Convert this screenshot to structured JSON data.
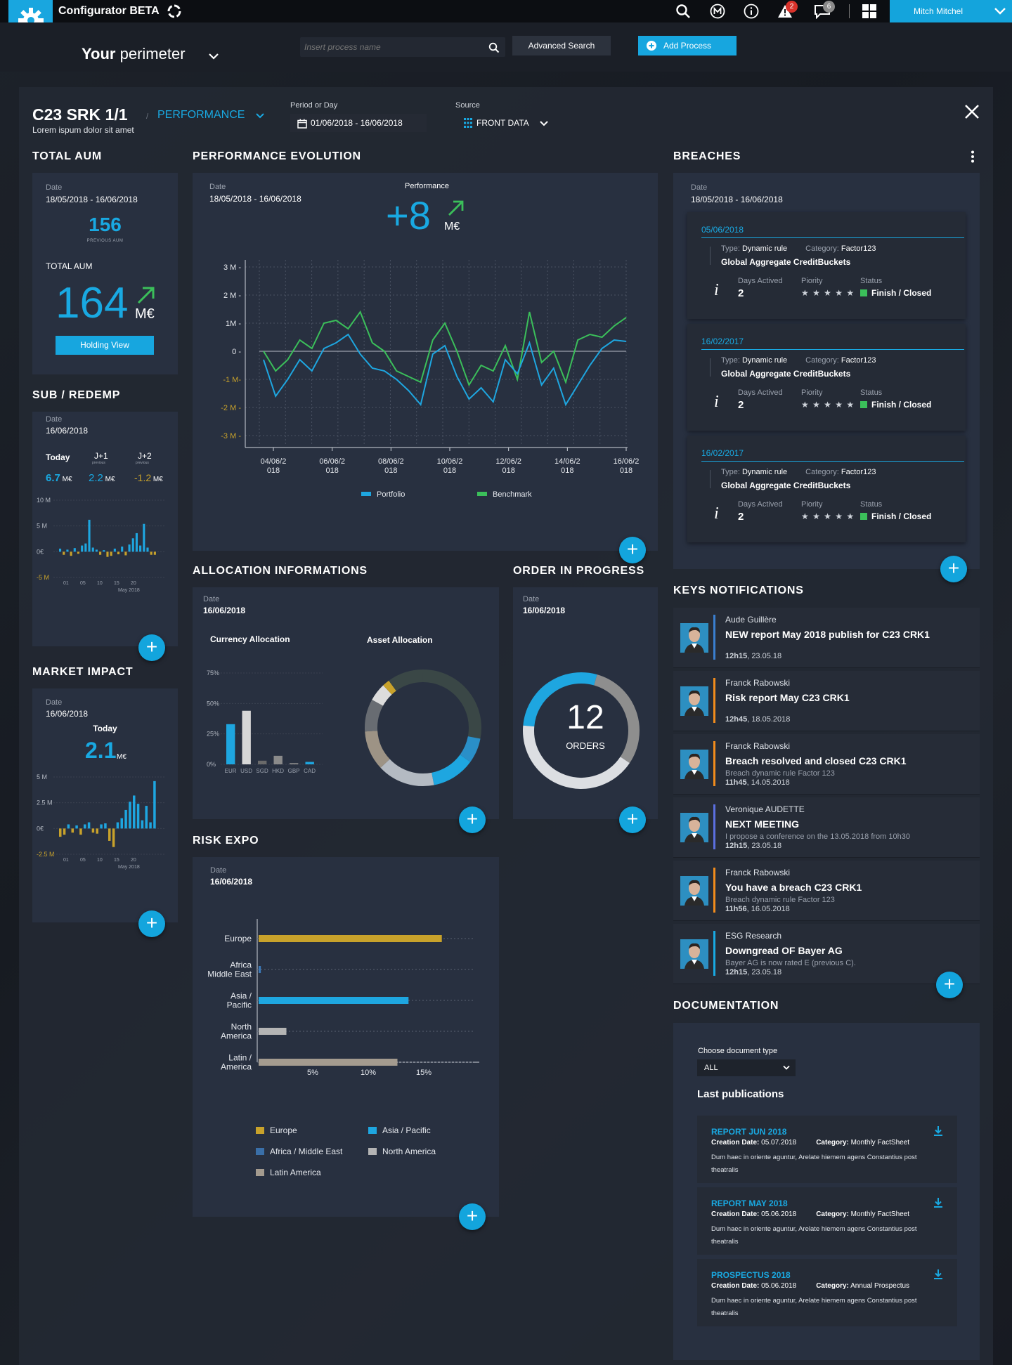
{
  "topbar": {
    "app_title": "Configurator BETA",
    "alerts_count": "2",
    "messages_count": "6",
    "user_name": "Mitch Mitchel"
  },
  "subbar": {
    "perimeter_bold": "Your",
    "perimeter_rest": " perimeter",
    "search_placeholder": "Insert process name",
    "advanced_search": "Advanced Search",
    "add_process": "Add Process"
  },
  "header": {
    "title": "C23 SRK 1/1",
    "subtitle": "Lorem ispum dolor sit amet",
    "view": "PERFORMANCE",
    "period_label": "Period or Day",
    "period_value": "01/06/2018 - 16/06/2018",
    "source_label": "Source",
    "source_value": "FRONT DATA"
  },
  "total_aum": {
    "title": "TOTAL AUM",
    "date_label": "Date",
    "date_value": "18/05/2018 - 16/06/2018",
    "previous_value": "156",
    "previous_label": "PREVIOUS AUM",
    "current_label": "TOTAL  AUM",
    "current_value": "164",
    "unit": "M€",
    "button": "Holding View"
  },
  "sub_redemp": {
    "title": "SUB / REDEMP",
    "date_label": "Date",
    "date_value": "16/06/2018",
    "today_label": "Today",
    "j1_label": "J+1",
    "j1_sub": "previous",
    "j2_label": "J+2",
    "j2_sub": "previous",
    "today_value": "6.7",
    "j1_value": "2.2",
    "j2_value": "-1.2",
    "unit": "M€",
    "y_ticks": [
      "10 M",
      "5 M",
      "0€",
      "-5 M"
    ],
    "x_ticks": [
      "01",
      "05",
      "10",
      "15",
      "20"
    ],
    "x_caption": "May 2018",
    "bars": [
      0.3,
      -0.3,
      0.2,
      -0.4,
      0.35,
      -0.2,
      0.6,
      0.8,
      3.1,
      0.4,
      0.2,
      -0.3,
      0.15,
      -0.5,
      -0.4,
      0.3,
      -0.25,
      0.5,
      -0.35,
      0.7,
      1.3,
      1.8,
      0.6,
      2.7,
      0.4,
      -0.3,
      -0.3
    ]
  },
  "market_impact": {
    "title": "MARKET IMPACT",
    "date_label": "Date",
    "date_value": "16/06/2018",
    "today_label": "Today",
    "value": "2.1",
    "unit": "M€",
    "y_ticks": [
      "5 M",
      "2.5 M",
      "0€",
      "-2.5 M"
    ],
    "x_ticks": [
      "01",
      "05",
      "10",
      "15",
      "20"
    ],
    "x_caption": "May 2018",
    "bars": [
      -0.4,
      -0.3,
      0.2,
      -0.2,
      0.15,
      -0.3,
      0.2,
      0.3,
      -0.2,
      -0.25,
      0.2,
      0.25,
      -0.6,
      -0.9,
      0.3,
      0.5,
      0.9,
      1.3,
      1.6,
      1.2,
      0.4,
      1.1,
      0.3,
      2.3
    ]
  },
  "performance": {
    "title": "PERFORMANCE EVOLUTION",
    "date_label": "Date",
    "date_value": "18/05/2018 - 16/06/2018",
    "perf_label": "Performance",
    "perf_value": "+8",
    "perf_unit": "M€"
  },
  "allocation": {
    "title": "ALLOCATION INFORMATIONS",
    "date_label": "Date",
    "date_value": "16/06/2018",
    "currency_title": "Currency Allocation",
    "asset_title": "Asset Allocation"
  },
  "order": {
    "title": "ORDER IN PROGRESS",
    "date_label": "Date",
    "date_value": "16/06/2018",
    "count": "12",
    "label": "ORDERS"
  },
  "risk": {
    "title": "RISK EXPO",
    "date_label": "Date",
    "date_value": "16/06/2018"
  },
  "breaches": {
    "title": "BREACHES",
    "date_label": "Date",
    "date_value": "18/05/2018 - 16/06/2018",
    "items": [
      {
        "date": "05/06/2018",
        "type_label": "Type:",
        "type": "Dynamic rule",
        "cat_label": "Category:",
        "category": "Factor123",
        "name": "Global Aggregate CreditBuckets",
        "days_label": "Days Actived",
        "days": "2",
        "priority_label": "Piority",
        "stars": "★ ★ ★ ★ ★",
        "status_label": "Status",
        "status": "Finish / Closed"
      },
      {
        "date": "16/02/2017",
        "type_label": "Type:",
        "type": "Dynamic rule",
        "cat_label": "Category:",
        "category": "Factor123",
        "name": "Global Aggregate CreditBuckets",
        "days_label": "Days Actived",
        "days": "2",
        "priority_label": "Piority",
        "stars": "★ ★ ★ ★ ★",
        "status_label": "Status",
        "status": "Finish / Closed"
      },
      {
        "date": "16/02/2017",
        "type_label": "Type:",
        "type": "Dynamic rule",
        "cat_label": "Category:",
        "category": "Factor123",
        "name": "Global Aggregate CreditBuckets",
        "days_label": "Days Actived",
        "days": "2",
        "priority_label": "Piority",
        "stars": "★ ★ ★ ★ ★",
        "status_label": "Status",
        "status": "Finish / Closed"
      }
    ]
  },
  "notifications": {
    "title": "KEYS NOTIFICATIONS",
    "items": [
      {
        "who": "Aude Guillère",
        "title": "NEW report May 2018 publish for C23 CRK1",
        "sub": "",
        "time_bold": "12h15",
        "time": ", 23.05.18",
        "color": "#3a7fd0"
      },
      {
        "who": "Franck Rabowski",
        "title": "Risk report May C23 CRK1",
        "sub": "",
        "time_bold": "12h45",
        "time": ", 18.05.2018",
        "color": "#f28c1c"
      },
      {
        "who": "Franck Rabowski",
        "title": "Breach resolved and closed C23 CRK1",
        "sub": "Breach dynamic rule Factor 123",
        "time_bold": "11h45",
        "time": ", 14.05.2018",
        "color": "#f28c1c"
      },
      {
        "who": "Veronique AUDETTE",
        "title": "NEXT MEETING",
        "sub": "I propose a conference on the 13.05.2018 from 10h30",
        "time_bold": "12h15",
        "time": ", 23.05.18",
        "color": "#5b6fe0"
      },
      {
        "who": "Franck Rabowski",
        "title": "You have a breach C23 CRK1",
        "sub": "Breach dynamic rule Factor 123",
        "time_bold": "11h56",
        "time": ", 16.05.2018",
        "color": "#f28c1c"
      },
      {
        "who": "ESG Research",
        "title": "Downgread OF Bayer AG",
        "sub": "Bayer AG is now rated E (previous C).",
        "time_bold": "12h15",
        "time": ", 23.05.18",
        "color": "#19a9e2"
      }
    ]
  },
  "documentation": {
    "title": "DOCUMENTATION",
    "choose_label": "Choose document type",
    "select_value": "ALL",
    "last_pub": "Last publications",
    "items": [
      {
        "title": "REPORT JUN 2018",
        "created_label": "Creation Date:",
        "created": " 05.07.2018",
        "cat_label": "Category:",
        "category": " Monthly FactSheet",
        "desc": "Dum haec in oriente aguntur, Arelate hiemem agens Constantius post theatralis"
      },
      {
        "title": "REPORT MAY 2018",
        "created_label": "Creation Date:",
        "created": " 05.06.2018",
        "cat_label": "Category:",
        "category": " Monthly FactSheet",
        "desc": "Dum haec in oriente aguntur, Arelate hiemem agens Constantius post theatralis"
      },
      {
        "title": "PROSPECTUS 2018",
        "created_label": "Creation Date:",
        "created": " 05.06.2018",
        "cat_label": "Category:",
        "category": " Annual Prospectus",
        "desc": "Dum haec in oriente aguntur, Arelate hiemem agens Constantius post theatralis"
      }
    ]
  },
  "chart_data": [
    {
      "type": "line",
      "title": "",
      "x": [
        "04/06/2018",
        "06/06/2018",
        "08/06/2018",
        "10/06/2018",
        "12/06/2018",
        "14/06/2018",
        "16/06/2018"
      ],
      "x_tick_labels": [
        "04/06/2\n018",
        "06/06/2\n018",
        "08/06/2\n018",
        "10/06/2\n018",
        "12/06/2\n018",
        "14/06/2\n018",
        "16/06/2\n018"
      ],
      "y_tick_labels": [
        "3 M -",
        "2 M -",
        "1M -",
        "0 -",
        "-1 M-",
        "-2 M -",
        "-3 M -"
      ],
      "ylim": [
        -3,
        3
      ],
      "series": [
        {
          "name": "Portfolio",
          "color": "#1ea6e0",
          "values": [
            -0.3,
            -1.6,
            -1.0,
            -0.3,
            -0.7,
            0.1,
            0.3,
            0.6,
            -0.1,
            -0.6,
            -0.7,
            -1.0,
            -1.4,
            -1.9,
            -0.1,
            0.2,
            -0.9,
            -1.7,
            -1.3,
            -1.8,
            -0.3,
            -0.8,
            0.3,
            -1.2,
            -0.6,
            -1.9,
            -1.2,
            -0.5,
            0.1,
            0.4,
            0.35
          ]
        },
        {
          "name": "Benchmark",
          "color": "#3bbf5a",
          "values": [
            0.0,
            -0.7,
            -0.3,
            0.4,
            0.1,
            1.0,
            1.1,
            0.8,
            1.4,
            0.3,
            0.0,
            -0.7,
            -0.9,
            -1.1,
            0.4,
            1.0,
            0.0,
            -1.2,
            -0.5,
            -0.7,
            0.2,
            -1.0,
            1.4,
            -0.4,
            0.0,
            -1.1,
            0.4,
            0.6,
            0.5,
            0.9,
            1.2
          ]
        }
      ]
    },
    {
      "type": "bar",
      "title": "Currency Allocation",
      "categories": [
        "EUR",
        "USD",
        "SGD",
        "HKD",
        "GBP",
        "CAD"
      ],
      "values": [
        33,
        44,
        3,
        7,
        1,
        2
      ],
      "y_tick_labels": [
        "75%",
        "50%",
        "25%",
        "0%"
      ],
      "ylim": [
        0,
        75
      ],
      "colors": [
        "#1ea6e0",
        "#d7d7d7",
        "#6a6a6a",
        "#8a8a8a",
        "#8a8a8a",
        "#1ea6e0"
      ]
    },
    {
      "type": "pie",
      "title": "Asset Allocation",
      "slices": [
        {
          "value": 28,
          "color": "#3a4746"
        },
        {
          "value": 7,
          "color": "#2a8fc8"
        },
        {
          "value": 12,
          "color": "#1ea6e0"
        },
        {
          "value": 16,
          "color": "#b4bac2"
        },
        {
          "value": 11,
          "color": "#9d9385"
        },
        {
          "value": 9,
          "color": "#686c72"
        },
        {
          "value": 5,
          "color": "#dcdcdc"
        },
        {
          "value": 2,
          "color": "#c8a22b"
        },
        {
          "value": 10,
          "color": "#3a4746"
        }
      ]
    },
    {
      "type": "pie",
      "title": "",
      "label": "ORDERS",
      "slices": [
        {
          "value": 28,
          "color": "#1ea6e0"
        },
        {
          "value": 30,
          "color": "#8e8e8e"
        },
        {
          "value": 42,
          "color": "#dcdee2"
        }
      ]
    },
    {
      "type": "bar",
      "orientation": "horizontal",
      "title": "",
      "categories": [
        "Europe",
        "Africa Middle East",
        "Asia / Pacific",
        "North America",
        "Latin / America"
      ],
      "category_lines": [
        [
          "Europe"
        ],
        [
          "Africa",
          "Middle East"
        ],
        [
          "Asia /",
          "Pacific"
        ],
        [
          "North",
          "America"
        ],
        [
          "Latin /",
          "America"
        ]
      ],
      "values": [
        16.5,
        0.2,
        13.5,
        2.5,
        12.5
      ],
      "colors": [
        "#c8a22b",
        "#3a78b8",
        "#1ea6e0",
        "#b4b4b4",
        "#a49b8f"
      ],
      "x_tick_labels": [
        "5%",
        "10%",
        "15%"
      ],
      "xlim": [
        0,
        20
      ],
      "legend": [
        {
          "name": "Europe",
          "color": "#c8a22b"
        },
        {
          "name": "Asia / Pacific",
          "color": "#1ea6e0"
        },
        {
          "name": "Africa / Middle East",
          "color": "#3a6fa8"
        },
        {
          "name": "North America",
          "color": "#b4b4b4"
        },
        {
          "name": "Latin America",
          "color": "#a49b8f"
        }
      ]
    }
  ]
}
